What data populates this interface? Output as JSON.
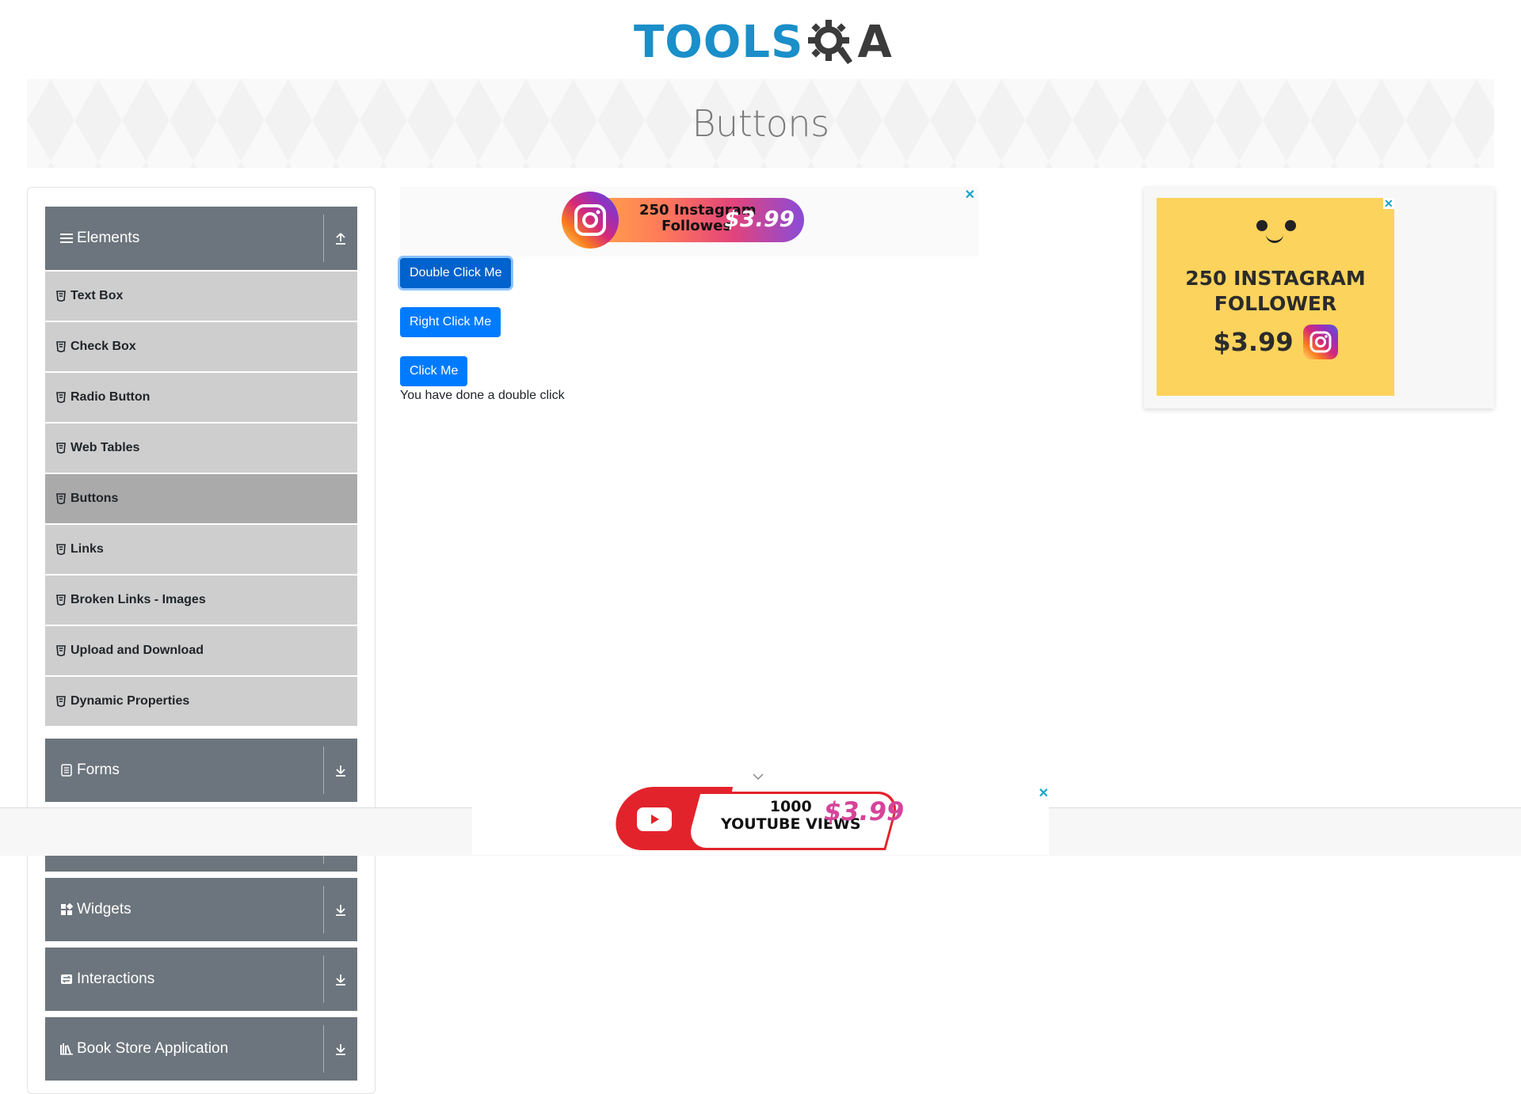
{
  "header": {
    "logo_text_left": "TOOLS",
    "logo_text_right": "A"
  },
  "banner": {
    "title": "Buttons"
  },
  "sidebar": {
    "elements": {
      "label": "Elements",
      "items": [
        {
          "label": "Text Box"
        },
        {
          "label": "Check Box"
        },
        {
          "label": "Radio Button"
        },
        {
          "label": "Web Tables"
        },
        {
          "label": "Buttons",
          "active": true
        },
        {
          "label": "Links"
        },
        {
          "label": "Broken Links - Images"
        },
        {
          "label": "Upload and Download"
        },
        {
          "label": "Dynamic Properties"
        }
      ]
    },
    "groups": [
      {
        "label": "Forms",
        "icon": "form-icon"
      },
      {
        "label": "Widgets",
        "icon": "widgets-icon"
      },
      {
        "label": "Interactions",
        "icon": "interactions-icon"
      },
      {
        "label": "Book Store Application",
        "icon": "book-icon"
      }
    ]
  },
  "main": {
    "double_click_label": "Double Click Me",
    "right_click_label": "Right Click Me",
    "click_label": "Click Me",
    "result_text": "You have done a double click"
  },
  "ads": {
    "top": {
      "line1": "250 Instagram",
      "line2": "Followes",
      "price": "$3.99",
      "close": "✕"
    },
    "right": {
      "line1": "250 INSTAGRAM",
      "line2": "FOLLOWER",
      "price": "$3.99",
      "close": "✕"
    },
    "bottom": {
      "line1": "1000",
      "line2": "YOUTUBE VIEWS",
      "price": "$3.99",
      "close": "✕"
    }
  },
  "colors": {
    "primary": "#007bff",
    "sidebar_header": "#6c757d",
    "menu_item": "#cecece",
    "menu_active": "#aaaaaa",
    "logo_blue": "#1a8fc9"
  }
}
